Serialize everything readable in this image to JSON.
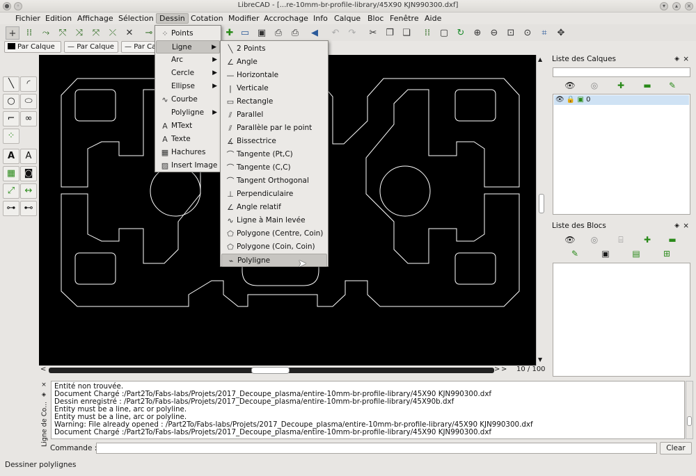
{
  "window": {
    "title": "LibreCAD - [...re-10mm-br-profile-library/45X90 KJN990300.dxf]"
  },
  "menubar": [
    "Fichier",
    "Edition",
    "Affichage",
    "Sélection",
    "Dessin",
    "Cotation",
    "Modifier",
    "Accrochage",
    "Info",
    "Calque",
    "Bloc",
    "Fenêtre",
    "Aide"
  ],
  "penbar": {
    "color": "Par Calque",
    "width": "Par Calque",
    "type": "Par Ca"
  },
  "dessin_menu": [
    {
      "label": "Points",
      "icon": "points-icon",
      "sub": false
    },
    {
      "label": "Ligne",
      "icon": "",
      "sub": true
    },
    {
      "label": "Arc",
      "icon": "",
      "sub": true
    },
    {
      "label": "Cercle",
      "icon": "",
      "sub": true
    },
    {
      "label": "Ellipse",
      "icon": "",
      "sub": true
    },
    {
      "label": "Courbe",
      "icon": "spline-icon",
      "sub": false
    },
    {
      "label": "Polyligne",
      "icon": "",
      "sub": true
    },
    {
      "label": "MText",
      "icon": "mtext-icon",
      "sub": false
    },
    {
      "label": "Texte",
      "icon": "text-icon",
      "sub": false
    },
    {
      "label": "Hachures",
      "icon": "hatch-icon",
      "sub": false
    },
    {
      "label": "Insert Image",
      "icon": "image-icon",
      "sub": false
    }
  ],
  "ligne_menu": [
    "2 Points",
    "Angle",
    "Horizontale",
    "Verticale",
    "Rectangle",
    "Parallel",
    "Parallèle par le point",
    "Bissectrice",
    "Tangente (Pt,C)",
    "Tangente (C,C)",
    "Tangent Orthogonal",
    "Perpendiculaire",
    "Angle relatif",
    "Ligne à Main levée",
    "Polygone (Centre, Coin)",
    "Polygone (Coin, Coin)",
    "Polyligne"
  ],
  "layers_panel": {
    "title": "Liste des Calques",
    "layer_name": "0"
  },
  "blocks_panel": {
    "title": "Liste des Blocs"
  },
  "page_counter": "10 / 100",
  "command_dock_title": "Ligne de Co...",
  "command_log": [
    "Entité non trouvée.",
    "Document Chargé :/Part2To/Fabs-labs/Projets/2017_Decoupe_plasma/entire-10mm-br-profile-library/45X90 KJN990300.dxf",
    "Dessin enregistré : /Part2To/Fabs-labs/Projets/2017_Decoupe_plasma/entire-10mm-br-profile-library/45X90b.dxf",
    "Entity must be a line, arc or polyline.",
    "Entity must be a line, arc or polyline.",
    "Warning: File already opened : /Part2To/Fabs-labs/Projets/2017_Decoupe_plasma/entire-10mm-br-profile-library/45X90 KJN990300.dxf",
    "Document Chargé :/Part2To/Fabs-labs/Projets/2017_Decoupe_plasma/entire-10mm-br-profile-library/45X90 KJN990300.dxf"
  ],
  "command": {
    "label": "Commande :",
    "value": "",
    "clear_label": "Clear"
  },
  "status": "Dessiner polylignes"
}
